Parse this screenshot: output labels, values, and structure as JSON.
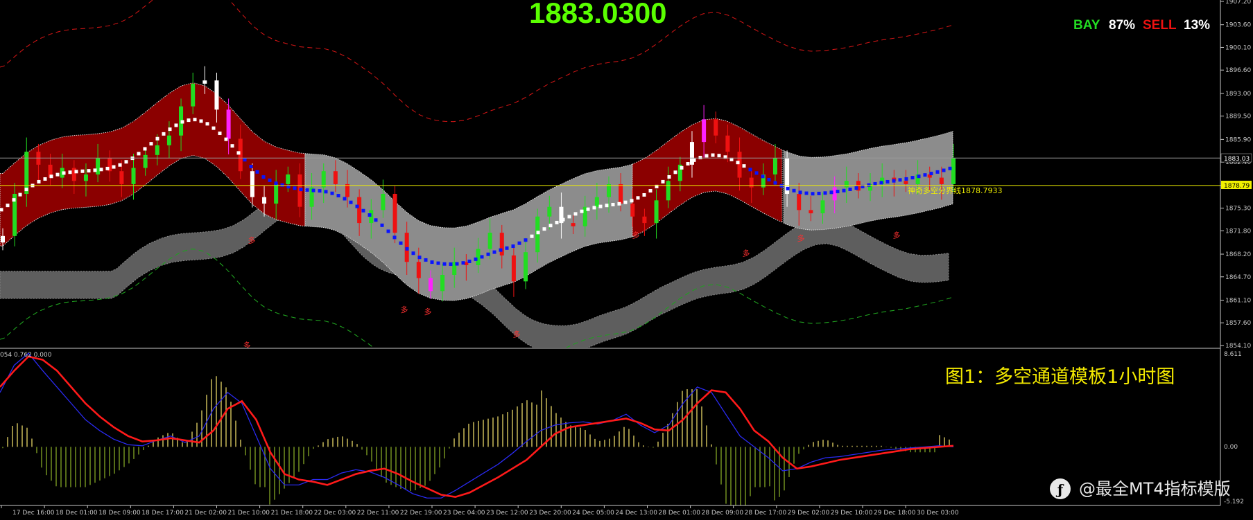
{
  "header": {
    "price": "1883.0300",
    "bay_label": "BAY",
    "bay_value": "87%",
    "sell_label": "SELL",
    "sell_value": "13%"
  },
  "annotations": {
    "divider_label": "神奇多空分界线1878.7933",
    "current_price_tag": "1883.03",
    "divider_price_tag": "1878.79",
    "signal_glyph": "多",
    "indicator_header": "054 0.762 0.000",
    "indicator_max": "8.611",
    "indicator_zero": "0.00",
    "indicator_min": "-5.192"
  },
  "caption": "图1：多空通道模板1小时图",
  "watermark": "@最全MT4指标模版",
  "colors": {
    "background": "#000000",
    "bull_candle": "#22dd22",
    "bear_candle": "#ee1111",
    "spike_candle": "#ffffff",
    "magenta_candle": "#ff22ff",
    "channel_red": "#8b0000",
    "channel_gray": "#8c8c8c",
    "trend_blue": "#0a14ff",
    "trend_white": "#ffffff",
    "divider_yellow": "#f0f000",
    "indicator_red": "#ff1a1a",
    "indicator_blue": "#2a2af0"
  },
  "chart_data": [
    {
      "type": "line",
      "title": "",
      "y_axis_ticks": [
        "1907.20",
        "1903.60",
        "1900.10",
        "1896.60",
        "1893.00",
        "1889.50",
        "1885.90",
        "1882.40",
        "1878.80",
        "1875.30",
        "1871.80",
        "1868.20",
        "1864.70",
        "1861.10",
        "1857.60",
        "1854.10"
      ],
      "ylim": [
        1854.1,
        1907.2
      ],
      "x_ticks": [
        "17 Dec 16:00",
        "18 Dec 01:00",
        "18 Dec 09:00",
        "18 Dec 17:00",
        "21 Dec 02:00",
        "21 Dec 10:00",
        "21 Dec 18:00",
        "22 Dec 03:00",
        "22 Dec 11:00",
        "22 Dec 19:00",
        "23 Dec 04:00",
        "23 Dec 12:00",
        "23 Dec 20:00",
        "24 Dec 05:00",
        "24 Dec 13:00",
        "28 Dec 01:00",
        "28 Dec 09:00",
        "28 Dec 17:00",
        "29 Dec 02:00",
        "29 Dec 10:00",
        "29 Dec 18:00",
        "30 Dec 03:00"
      ],
      "current_price": 1883.03,
      "divider_level": 1878.79,
      "series": [
        {
          "values": [
            1871.0,
            1877.5,
            1884.0,
            1882.0,
            1880.0,
            1881.5,
            1879.5,
            1880.5,
            1883.0,
            1881.0,
            1879.0,
            1881.5,
            1883.5,
            1885.0,
            1886.5,
            1891.0,
            1894.5,
            1895.0,
            1890.5,
            1886.0,
            1881.0,
            1877.0,
            1876.0,
            1879.0,
            1880.5,
            1875.5,
            1878.5,
            1881.0,
            1879.0,
            1877.0,
            1873.0,
            1875.0,
            1877.5,
            1871.5,
            1867.0,
            1864.5,
            1862.5,
            1865.0,
            1867.0,
            1866.5,
            1869.0,
            1871.5,
            1868.0,
            1864.0,
            1868.5,
            1874.0,
            1875.5,
            1873.0,
            1872.5,
            1875.5,
            1877.0,
            1879.0,
            1876.0,
            1874.0,
            1873.0,
            1876.5,
            1879.5,
            1882.0,
            1885.5,
            1889.0,
            1886.5,
            1884.0,
            1880.0,
            1878.5,
            1880.5,
            1883.0,
            1877.5,
            1875.0,
            1874.5,
            1876.5,
            1878.5,
            1879.5,
            1878.0,
            1879.0,
            1880.0,
            1879.5,
            1879.0,
            1880.5,
            1880.0,
            1879.0,
            1883.0
          ]
        }
      ]
    },
    {
      "type": "line",
      "title": "",
      "ylim": [
        -5.192,
        8.611
      ],
      "series": [
        {
          "values": [
            5.5,
            7.0,
            8.3,
            8.0,
            7.0,
            5.5,
            4.0,
            2.8,
            1.8,
            1.0,
            0.5,
            0.6,
            0.8,
            0.6,
            0.4,
            1.5,
            3.5,
            4.2,
            2.5,
            -0.5,
            -2.5,
            -3.0,
            -3.2,
            -3.5,
            -3.0,
            -2.5,
            -2.2,
            -2.0,
            -2.5,
            -3.2,
            -3.8,
            -4.4,
            -4.6,
            -4.2,
            -3.5,
            -2.8,
            -2.0,
            -1.2,
            0.0,
            1.2,
            1.8,
            2.0,
            2.2,
            2.4,
            2.6,
            2.2,
            1.6,
            1.5,
            2.5,
            4.0,
            5.2,
            5.0,
            3.5,
            1.5,
            0.5,
            -1.0,
            -2.0,
            -1.8,
            -1.5,
            -1.2,
            -1.0,
            -0.8,
            -0.6,
            -0.4,
            -0.2,
            -0.1,
            0.0,
            0.1
          ]
        },
        {
          "values": [
            5.0,
            7.5,
            8.6,
            7.0,
            5.5,
            4.0,
            2.5,
            1.5,
            0.7,
            0.2,
            0.1,
            0.6,
            1.0,
            0.4,
            1.0,
            3.5,
            5.0,
            4.0,
            1.0,
            -2.0,
            -3.5,
            -3.5,
            -3.0,
            -3.0,
            -2.4,
            -2.1,
            -2.3,
            -2.8,
            -3.5,
            -4.3,
            -4.7,
            -4.7,
            -4.0,
            -3.2,
            -2.4,
            -1.6,
            -0.6,
            0.5,
            1.5,
            2.0,
            2.2,
            2.3,
            2.1,
            2.4,
            3.0,
            2.0,
            1.3,
            2.0,
            4.0,
            5.5,
            5.0,
            3.0,
            1.0,
            0.0,
            -1.0,
            -2.2,
            -2.0,
            -1.4,
            -1.0,
            -0.9,
            -0.7,
            -0.5,
            -0.3,
            -0.2,
            -0.1,
            0.0,
            0.1,
            0.0
          ]
        }
      ]
    }
  ]
}
